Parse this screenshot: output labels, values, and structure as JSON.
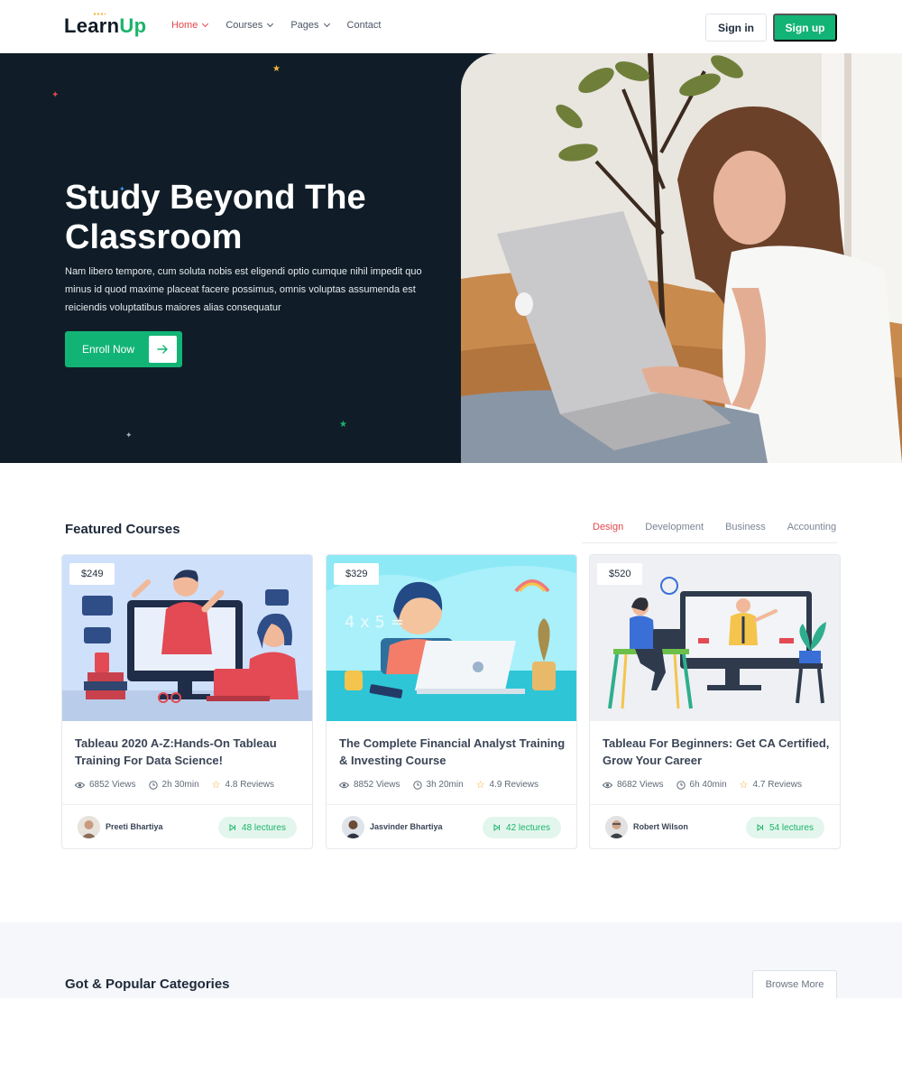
{
  "nav": {
    "logo_main": "Learn",
    "logo_accent": "Up",
    "menu": [
      {
        "label": "Home",
        "active": true
      },
      {
        "label": "Courses",
        "active": false
      },
      {
        "label": "Pages",
        "active": false
      },
      {
        "label": "Contact",
        "active": false
      }
    ],
    "signin_label": "Sign in",
    "signup_label": "Sign up"
  },
  "hero": {
    "title": "Study Beyond The Classroom",
    "description": "Nam libero tempore, cum soluta nobis est eligendi optio cumque nihil impedit quo minus id quod maxime placeat facere possimus, omnis voluptas assumenda est reiciendis voluptatibus maiores alias consequatur",
    "cta_label": "Enroll Now"
  },
  "featured": {
    "title": "Featured Courses",
    "tabs": [
      {
        "label": "Design",
        "active": true
      },
      {
        "label": "Development",
        "active": false
      },
      {
        "label": "Business",
        "active": false
      },
      {
        "label": "Accounting",
        "active": false
      }
    ],
    "courses": [
      {
        "price": "$249",
        "title": "Tableau 2020 A-Z:Hands-On Tableau Training For Data Science!",
        "views": "6852 Views",
        "duration": "2h 30min",
        "reviews": "4.8 Reviews",
        "author": "Preeti Bhartiya",
        "lectures": "48 lectures"
      },
      {
        "price": "$329",
        "title": "The Complete Financial Analyst Training & Investing Course",
        "views": "8852 Views",
        "duration": "3h 20min",
        "reviews": "4.9 Reviews",
        "author": "Jasvinder Bhartiya",
        "lectures": "42 lectures"
      },
      {
        "price": "$520",
        "title": "Tableau For Beginners: Get CA Certified, Grow Your Career",
        "views": "8682 Views",
        "duration": "6h 40min",
        "reviews": "4.7 Reviews",
        "author": "Robert Wilson",
        "lectures": "54 lectures"
      }
    ]
  },
  "categories": {
    "title": "Got & Popular Categories",
    "browse_label": "Browse More"
  },
  "colors": {
    "brand_green": "#12b475",
    "accent_red": "#e2474b",
    "hero_bg": "#101d28"
  }
}
